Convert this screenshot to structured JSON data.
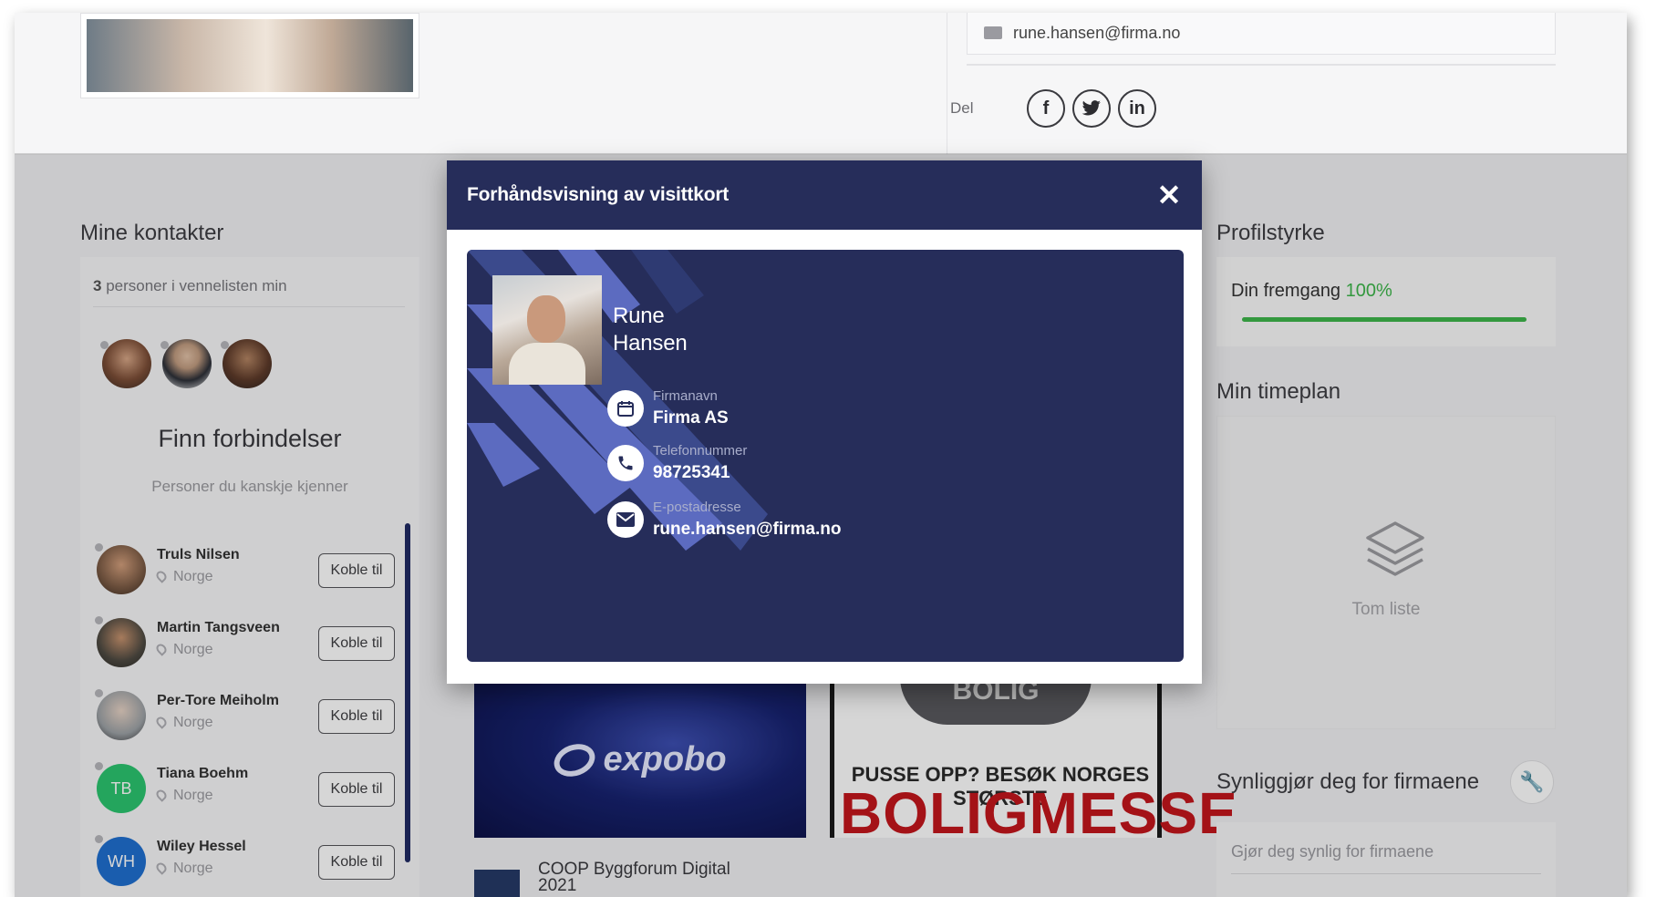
{
  "profile": {
    "email": "rune.hansen@firma.no"
  },
  "share": {
    "label": "Del",
    "facebook": "f",
    "twitter": "t",
    "linkedin": "in"
  },
  "contacts": {
    "title": "Mine kontakter",
    "count": "3",
    "count_suffix": "personer i vennelisten min",
    "find_title": "Finn forbindelser",
    "find_subtitle": "Personer du kanskje kjenner",
    "people": [
      {
        "name": "Truls Nilsen",
        "location": "Norge",
        "button": "Koble til",
        "initials": "",
        "color": "#7a5a44"
      },
      {
        "name": "Martin Tangsveen",
        "location": "Norge",
        "button": "Koble til",
        "initials": "",
        "color": "#4e4a42"
      },
      {
        "name": "Per-Tore Meiholm",
        "location": "Norge",
        "button": "Koble til",
        "initials": "",
        "color": "#9da2a6"
      },
      {
        "name": "Tiana Boehm",
        "location": "Norge",
        "button": "Koble til",
        "initials": "TB",
        "color": "#2cc56f"
      },
      {
        "name": "Wiley Hessel",
        "location": "Norge",
        "button": "Koble til",
        "initials": "WH",
        "color": "#1f6fd0"
      }
    ]
  },
  "banners": {
    "expo": "expobo",
    "bolig_top": "BOLIG",
    "bolig_line1": "PUSSE OPP? BESØK NORGES STØRSTE",
    "bolig_line2": "BOLIGMESSE",
    "event_title": "COOP Byggforum Digital",
    "event_title_2": "2021"
  },
  "sidebar": {
    "strength_title": "Profilstyrke",
    "progress_label": "Din fremgang",
    "progress_value": "100%",
    "progress_fraction": 1.0,
    "schedule_title": "Min timeplan",
    "schedule_empty": "Tom liste",
    "visible_title": "Synliggjør deg for firmaene",
    "visible_placeholder": "Gjør deg synlig for firmaene"
  },
  "modal": {
    "title": "Forhåndsvisning av visittkort",
    "close": "✕",
    "card": {
      "first_name": "Rune",
      "last_name": "Hansen",
      "fields": [
        {
          "label": "Firmanavn",
          "value": "Firma AS",
          "icon": "calendar-icon"
        },
        {
          "label": "Telefonnummer",
          "value": "98725341",
          "icon": "phone-icon"
        },
        {
          "label": "E-postadresse",
          "value": "rune.hansen@firma.no",
          "icon": "envelope-icon"
        }
      ]
    }
  },
  "colors": {
    "navy": "#262d5a",
    "accent_stripe": "#5c6bc0",
    "success": "#3db54a"
  }
}
